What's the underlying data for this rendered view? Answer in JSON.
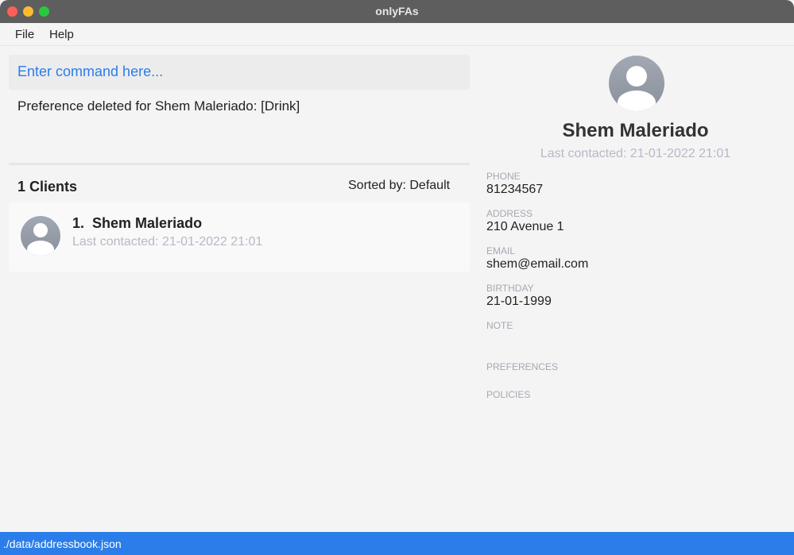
{
  "window": {
    "title": "onlyFAs",
    "colors": {
      "close": "#fe5f57",
      "minimize": "#febc2e",
      "maximize": "#28c840"
    }
  },
  "menu": {
    "items": [
      "File",
      "Help"
    ]
  },
  "command": {
    "placeholder": "Enter command here..."
  },
  "result": "Preference deleted for Shem Maleriado: [Drink]",
  "list": {
    "count_label": "1 Clients",
    "sorted_label": "Sorted by: Default",
    "clients": [
      {
        "index": "1.",
        "name": "Shem Maleriado",
        "last_contacted": "Last contacted: 21-01-2022 21:01"
      }
    ]
  },
  "profile": {
    "name": "Shem Maleriado",
    "last_contacted": "Last contacted: 21-01-2022 21:01",
    "fields": [
      {
        "label": "PHONE",
        "value": "81234567"
      },
      {
        "label": "ADDRESS",
        "value": "210 Avenue 1"
      },
      {
        "label": "EMAIL",
        "value": "shem@email.com"
      },
      {
        "label": "BIRTHDAY",
        "value": "21-01-1999"
      },
      {
        "label": "NOTE",
        "value": ""
      },
      {
        "label": "PREFERENCES",
        "value": ""
      },
      {
        "label": "POLICIES",
        "value": ""
      }
    ]
  },
  "status": "./data/addressbook.json",
  "accent": "#2b7de9"
}
